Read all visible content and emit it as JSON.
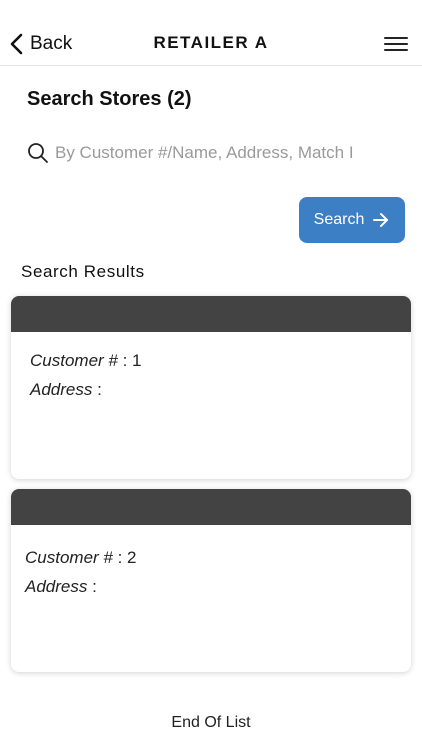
{
  "header": {
    "back_label": "Back",
    "title": "RETAILER A"
  },
  "search": {
    "title": "Search Stores (2)",
    "placeholder": "By Customer #/Name, Address, Match I",
    "button_label": "Search"
  },
  "results": {
    "title": "Search Results",
    "items": [
      {
        "customer_label": "Customer #",
        "customer_value": "1",
        "address_label": "Address",
        "address_value": ""
      },
      {
        "customer_label": "Customer #",
        "customer_value": "2",
        "address_label": "Address",
        "address_value": ""
      }
    ],
    "end_text": "End Of List"
  },
  "colors": {
    "accent": "#3d7fc5",
    "card_header": "#434343"
  },
  "icons": {
    "back": "chevron-left-icon",
    "menu": "hamburger-menu-icon",
    "search": "search-icon",
    "arrow": "arrow-right-icon"
  }
}
